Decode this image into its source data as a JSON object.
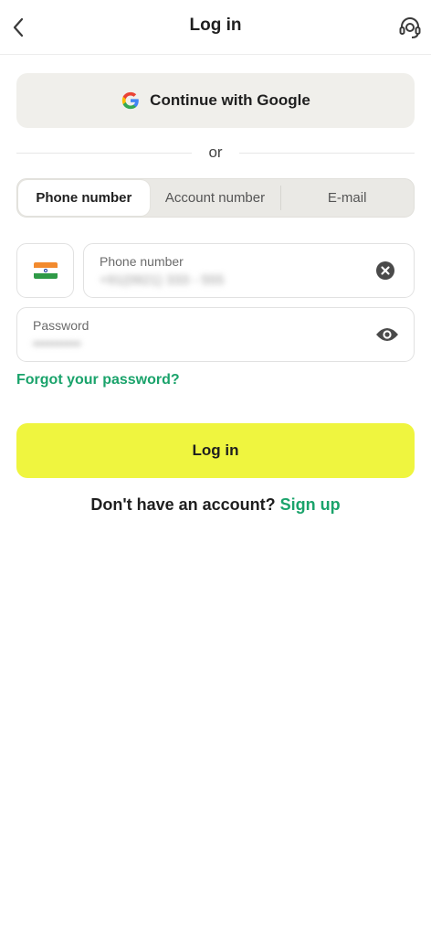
{
  "header": {
    "title": "Log in",
    "back_icon": "chevron-left-icon",
    "support_icon": "headset-support-icon"
  },
  "google": {
    "label": "Continue with Google",
    "icon": "google-logo-icon"
  },
  "divider": {
    "text": "or"
  },
  "tabs": [
    {
      "label": "Phone number",
      "active": true
    },
    {
      "label": "Account number",
      "active": false
    },
    {
      "label": "E-mail",
      "active": false
    }
  ],
  "phone": {
    "country_flag": "india-flag-icon",
    "label": "Phone number",
    "value": "+91(0921) 333 - 555",
    "clear_icon": "clear-circle-icon"
  },
  "password": {
    "label": "Password",
    "value": "••••••••••",
    "toggle_icon": "eye-icon"
  },
  "forgot_label": "Forgot your password?",
  "login_label": "Log in",
  "signup": {
    "prompt": "Don't have an account?",
    "link": "Sign up"
  },
  "colors": {
    "accent_green": "#1aa36b",
    "login_yellow": "#eff53f",
    "google_bg": "#f0efeb"
  }
}
